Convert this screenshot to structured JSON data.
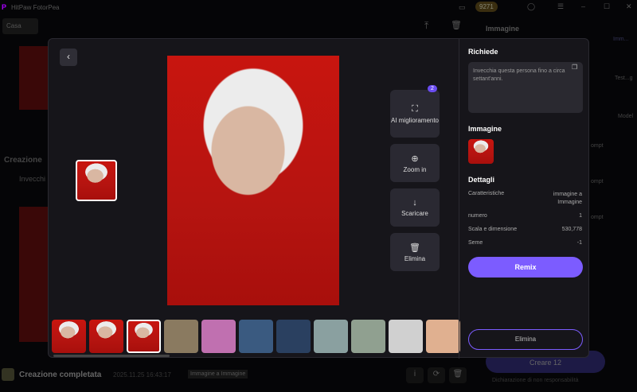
{
  "app": {
    "title": "HitPaw FotorPea",
    "credits": "9271",
    "home": "Casa"
  },
  "background": {
    "creation_title": "Creazione",
    "creation_text": "Invecchi",
    "completed": "Creazione completata",
    "timestamp": "2025.11.25 16:43:17",
    "tag": "Immagine a Immagine",
    "panel_title": "Immagine",
    "create_label": "Creare",
    "create_cost": "12",
    "disclaimer": "Dichiarazione di non responsabilità",
    "prompt_labels": [
      "ompt",
      "ompt",
      "ompt"
    ],
    "side_nav": [
      "Imm...",
      "Test...g",
      "Model"
    ]
  },
  "viewer": {
    "badge_count": "2",
    "actions": [
      {
        "label": "AI miglioramento",
        "icon": "enhance-icon"
      },
      {
        "label": "Zoom in",
        "icon": "zoom-in-icon"
      },
      {
        "label": "Scaricare",
        "icon": "download-icon"
      },
      {
        "label": "Elimina",
        "icon": "trash-icon"
      }
    ]
  },
  "details": {
    "prompt_heading": "Richiede",
    "prompt_text": "Invecchia questa persona fino a circa settant'anni.",
    "image_heading": "Immagine",
    "details_heading": "Dettagli",
    "rows": [
      {
        "label": "Caratteristiche",
        "value": "immagine a Immagine"
      },
      {
        "label": "numero",
        "value": "1"
      },
      {
        "label": "Scala e dimensione",
        "value": "530,778"
      },
      {
        "label": "Seme",
        "value": "-1"
      }
    ],
    "remix": "Remix",
    "delete": "Elimina",
    "accent": "#7c5cff"
  },
  "strip": {
    "thumb_colors": [
      "#c41a14",
      "#c41a14",
      "#c41a14",
      "#8a7a60",
      "#c070b0",
      "#3a5a80",
      "#2a4060",
      "#8aa0a0",
      "#90a090",
      "#d0d0d0",
      "#e0b090"
    ]
  }
}
